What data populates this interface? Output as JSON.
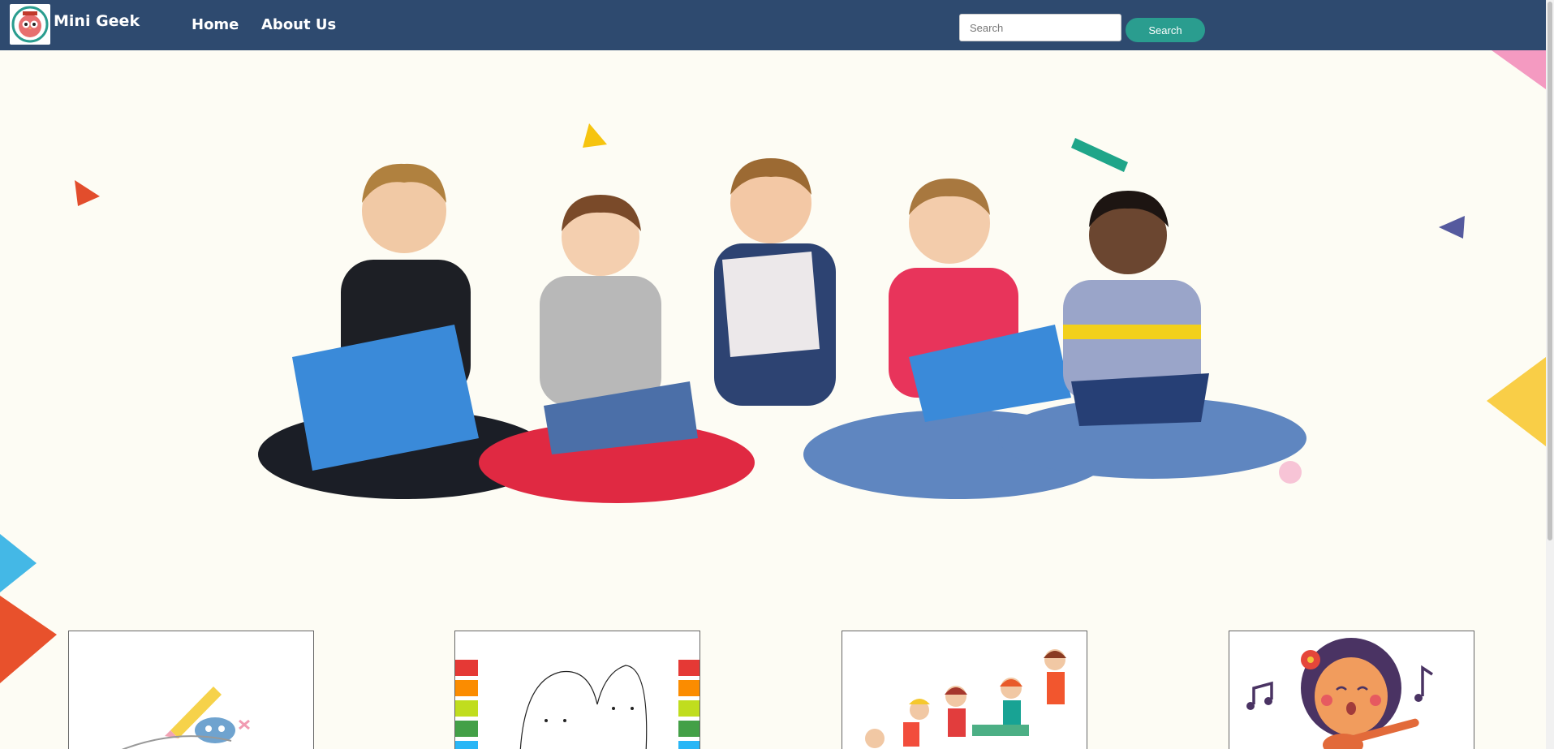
{
  "header": {
    "brand": "Mini Geek",
    "nav": [
      "Home",
      "About Us"
    ],
    "search_placeholder": "Search",
    "search_button": "Search"
  },
  "hero": {
    "image": "children-reading-books"
  },
  "cards": [
    {
      "image": "drawing-illustration"
    },
    {
      "image": "coloring-page-markers"
    },
    {
      "image": "kids-cartoon-group"
    },
    {
      "image": "girl-singing-guitar"
    }
  ],
  "colors": {
    "navbar": "#2e4a6f",
    "accent": "#2a9d8f",
    "page_bg": "#fdfcf4"
  }
}
